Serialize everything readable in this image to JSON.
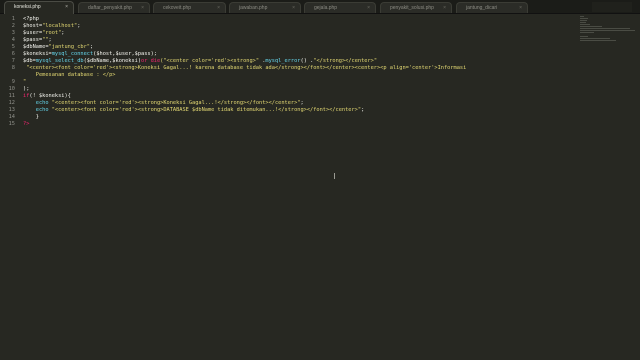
{
  "tabs": [
    {
      "label": "koneksi.php",
      "active": true
    },
    {
      "label": "daftar_penyakit.php",
      "active": false
    },
    {
      "label": "cekoveit.php",
      "active": false
    },
    {
      "label": "jawaban.php",
      "active": false
    },
    {
      "label": "gejala.php",
      "active": false
    },
    {
      "label": "penyakit_solusi.php",
      "active": false
    },
    {
      "label": "jantung_dicari",
      "active": false
    }
  ],
  "tab_close_glyph": "×",
  "line_numbers": [
    "1",
    "2",
    "3",
    "4",
    "5",
    "6",
    "7",
    "8",
    "9",
    "10",
    "11",
    "12",
    "13",
    "14",
    "15"
  ],
  "code": {
    "l1": "<?php",
    "l2_var": "$host=",
    "l2_str": "\"localhost\"",
    "l2_end": ";",
    "l3_var": "$user=",
    "l3_str": "\"root\"",
    "l3_end": ";",
    "l4_var": "$pass=",
    "l4_str": "\"\"",
    "l4_end": ";",
    "l5_var": "$dbName=",
    "l5_str": "\"jantung_cbr\"",
    "l5_end": ";",
    "l6_a": "$koneksi=",
    "l6_fn": "mysql_connect",
    "l6_b": "($host,$user,$pass);",
    "l7_a": "$db=",
    "l7_fn": "mysql_select_db",
    "l7_b": "($dbName,$koneksi)",
    "l7_kw": "or die",
    "l7_str1": "(\"<center color='red'><strong>\"",
    "l7_c": " .",
    "l7_fn2": "mysql_error",
    "l7_d": "() .",
    "l7_str2": "\"</strong></center>\"",
    "l8_str": " \"<center><font color='red'><strong>Koneksi Gagal...! karena database tidak ada</strong></font></center><center><p align='center'>Informasi",
    "l8b_str": "    Pemesanan database : </p>",
    "l9": "\"",
    "l10": ");",
    "l11_kw": "if",
    "l11_b": "(! $koneksi){",
    "l12_a": "    echo",
    "l12_str": "\"<center><font color='red'><strong>Koneksi Gagal...!</strong></font></center>\"",
    "l12_end": ";",
    "l13_a": "    echo",
    "l13_str": "\"<center><font color='red'><strong>DATABASE $dbName tidak ditemukan...!</strong></font></center>\"",
    "l13_end": ";",
    "l14": "    }",
    "l15": "?>"
  },
  "colors": {
    "background": "#272822",
    "keyword": "#f92672",
    "string": "#e6db74",
    "function": "#66d9ef",
    "text": "#f8f8f2"
  }
}
